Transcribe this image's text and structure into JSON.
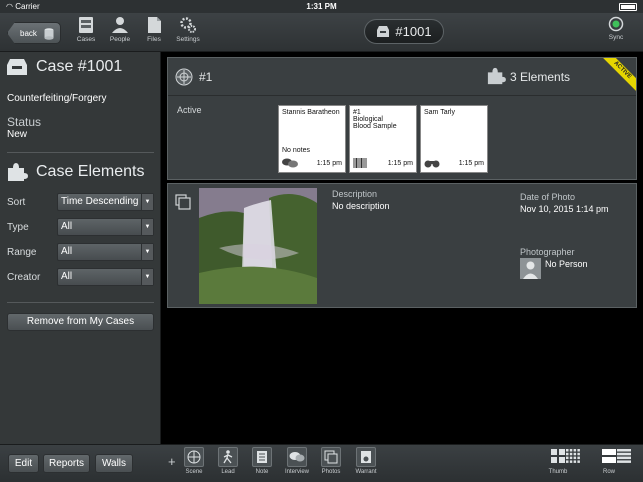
{
  "status_bar": {
    "carrier": "Carrier",
    "time": "1:31 PM"
  },
  "toolbar": {
    "back_label": "back",
    "items": [
      {
        "label": "Cases",
        "icon": "cases-icon"
      },
      {
        "label": "People",
        "icon": "people-icon"
      },
      {
        "label": "Files",
        "icon": "files-icon"
      },
      {
        "label": "Settings",
        "icon": "settings-icon"
      }
    ],
    "case_pill": "#1001",
    "sync_label": "Sync"
  },
  "sidebar": {
    "case_title": "Case #1001",
    "case_type": "Counterfeiting/Forgery",
    "status_label": "Status",
    "status_value": "New",
    "elements_title": "Case Elements",
    "filters": [
      {
        "label": "Sort",
        "value": "Time Descending"
      },
      {
        "label": "Type",
        "value": "All"
      },
      {
        "label": "Range",
        "value": "All"
      },
      {
        "label": "Creator",
        "value": "All"
      }
    ],
    "remove_button": "Remove from My Cases"
  },
  "panel1": {
    "case_number": "#1",
    "elements_count": "3 Elements",
    "ribbon": "ACTIVE",
    "row_label": "Active",
    "cards": [
      {
        "line1": "Stannis Baratheon",
        "line2": "",
        "line3": "",
        "note": "No notes",
        "time": "1:15 pm",
        "icon": "interview-icon"
      },
      {
        "line1": "#1",
        "line2": "Biological",
        "line3": "Blood Sample",
        "note": "",
        "time": "1:15 pm",
        "icon": "barcode-icon"
      },
      {
        "line1": "Sam Tarly",
        "line2": "",
        "line3": "",
        "note": "",
        "time": "1:15 pm",
        "icon": "binoculars-icon"
      }
    ]
  },
  "panel2": {
    "description_label": "Description",
    "description_value": "No description",
    "date_label": "Date of Photo",
    "date_value": "Nov 10, 2015 1:14 pm",
    "photographer_label": "Photographer",
    "photographer_value": "No Person"
  },
  "bottom_bar": {
    "edit": "Edit",
    "reports": "Reports",
    "walls": "Walls",
    "add_symbol": "+",
    "items": [
      {
        "label": "Scene",
        "icon": "scene-icon"
      },
      {
        "label": "Lead",
        "icon": "lead-icon"
      },
      {
        "label": "Note",
        "icon": "note-icon"
      },
      {
        "label": "Interview",
        "icon": "interview-icon"
      },
      {
        "label": "Photos",
        "icon": "photos-icon"
      },
      {
        "label": "Warrant",
        "icon": "warrant-icon"
      }
    ],
    "views": [
      {
        "label": "Thumb",
        "icon": "thumb-view-icon"
      },
      {
        "label": "",
        "icon": "grid-view-icon"
      },
      {
        "label": "Row",
        "icon": "row-view-icon"
      },
      {
        "label": "",
        "icon": "list-view-icon"
      }
    ]
  }
}
